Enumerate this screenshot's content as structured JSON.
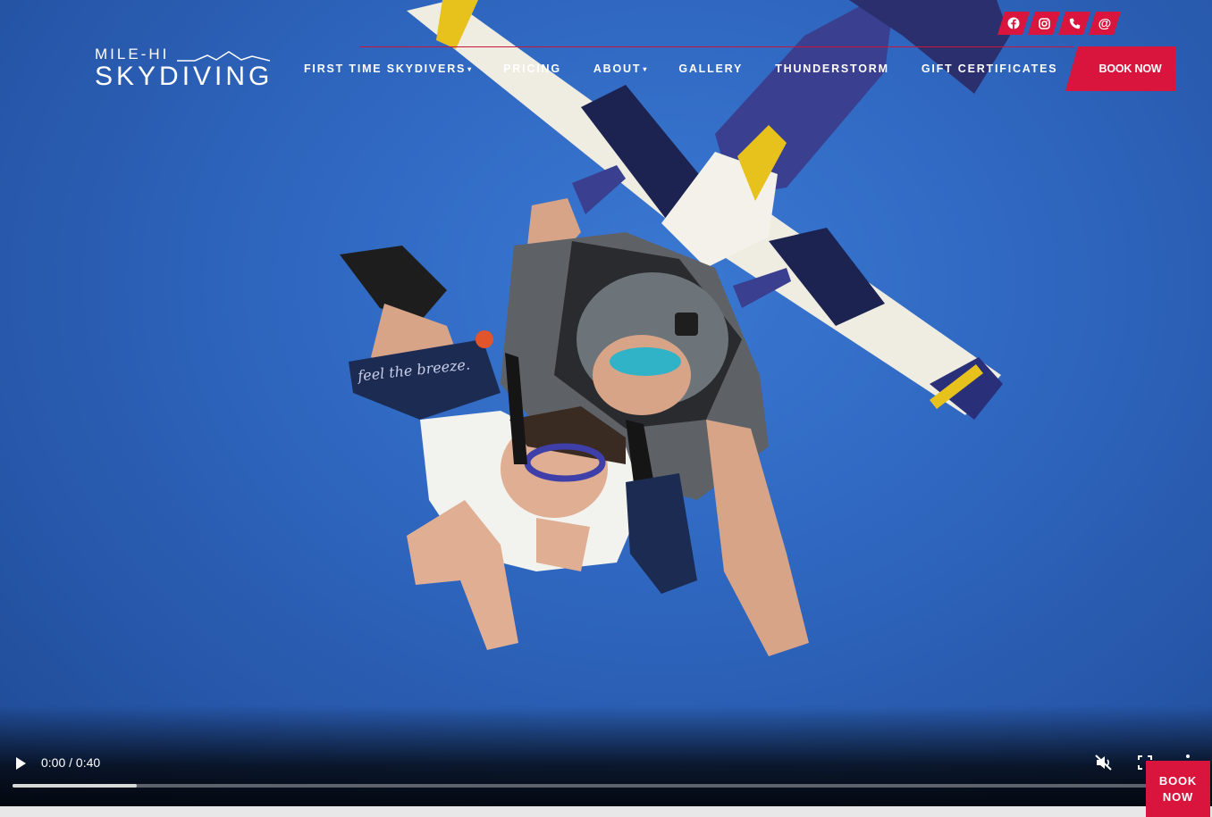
{
  "brand": {
    "logo_small": "MILE-HI",
    "logo_big": "SKYDIVING"
  },
  "social_icons": [
    "facebook-icon",
    "instagram-icon",
    "phone-icon",
    "email-at-icon"
  ],
  "nav": {
    "items": [
      {
        "label": "FIRST TIME SKYDIVERS",
        "dropdown": true
      },
      {
        "label": "PRICING",
        "dropdown": false
      },
      {
        "label": "ABOUT",
        "dropdown": true
      },
      {
        "label": "GALLERY",
        "dropdown": false
      },
      {
        "label": "THUNDERSTORM",
        "dropdown": false
      },
      {
        "label": "GIFT CERTIFICATES",
        "dropdown": false
      }
    ],
    "caret": "▾",
    "book_label": "BOOK NOW"
  },
  "hero": {
    "jumpsuit_text": "feel the breeze."
  },
  "video": {
    "time_display": "0:00 / 0:40",
    "progress_fraction": 0.105,
    "muted": true
  },
  "floating_book": {
    "line1": "BOOK",
    "line2": "NOW"
  },
  "colors": {
    "accent_red": "#d9153d",
    "sky_blue": "#2f67c0",
    "white": "#ffffff"
  }
}
